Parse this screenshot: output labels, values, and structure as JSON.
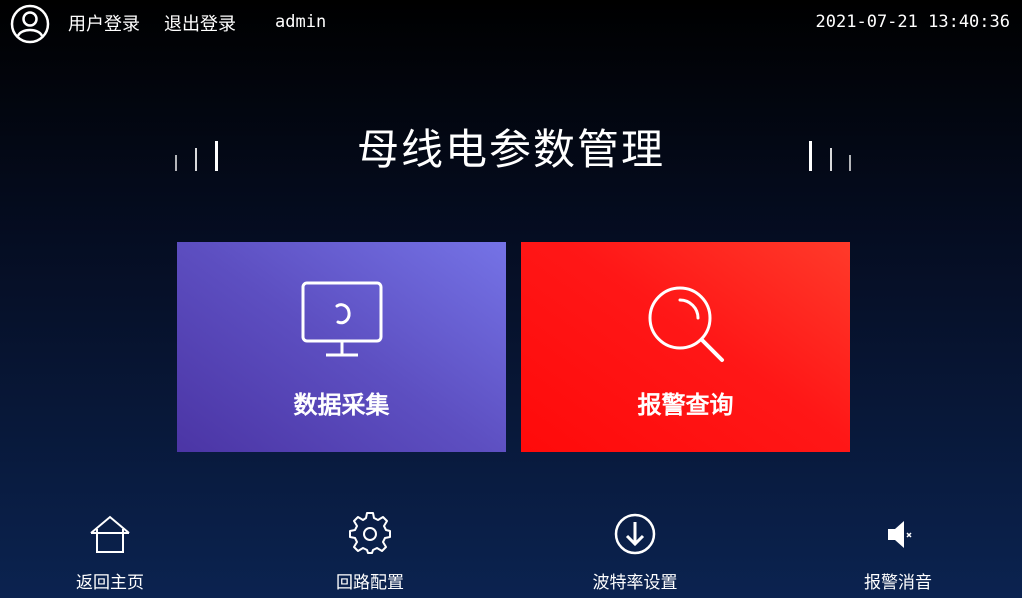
{
  "topbar": {
    "login_label": "用户登录",
    "logout_label": "退出登录",
    "username": "admin",
    "datetime": "2021-07-21 13:40:36"
  },
  "page_title": "母线电参数管理",
  "tiles": [
    {
      "label": "数据采集",
      "icon": "monitor-refresh-icon",
      "color": "#5d4fc1"
    },
    {
      "label": "报警查询",
      "icon": "magnifier-icon",
      "color": "#ff1717"
    }
  ],
  "bottom_nav": [
    {
      "label": "返回主页",
      "icon": "home-icon"
    },
    {
      "label": "回路配置",
      "icon": "gear-icon"
    },
    {
      "label": "波特率设置",
      "icon": "download-circle-icon"
    },
    {
      "label": "报警消音",
      "icon": "mute-speaker-icon"
    }
  ],
  "colors": {
    "background_top": "#000000",
    "background_bottom": "#0b2350",
    "tile_data": "#5d4fc1",
    "tile_alarm": "#ff1717"
  }
}
